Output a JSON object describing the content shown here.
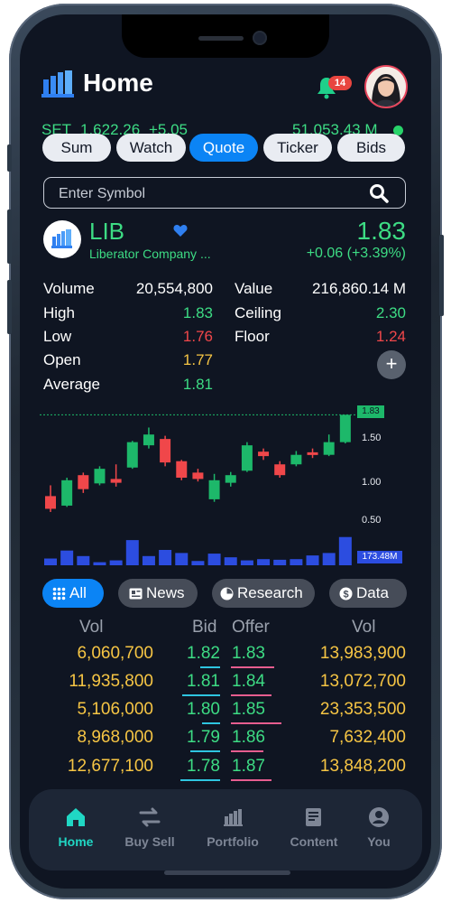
{
  "header": {
    "title": "Home",
    "notification_count": "14"
  },
  "market": {
    "index_name": "SET",
    "index_value": "1,622.26",
    "index_change": "+5.05",
    "value": "51,053.43 M"
  },
  "tabs": [
    {
      "label": "Sum"
    },
    {
      "label": "Watch"
    },
    {
      "label": "Quote",
      "active": true
    },
    {
      "label": "Ticker"
    },
    {
      "label": "Bids"
    }
  ],
  "search": {
    "placeholder": "Enter Symbol"
  },
  "stock": {
    "symbol": "LIB",
    "company": "Liberator Company ...",
    "price": "1.83",
    "change": "+0.06 (+3.39%)"
  },
  "stats_left": [
    {
      "label": "Volume",
      "value": "20,554,800",
      "color": "#ffffff"
    },
    {
      "label": "High",
      "value": "1.83",
      "color": "#3ddc84"
    },
    {
      "label": "Low",
      "value": "1.76",
      "color": "#f0474a"
    },
    {
      "label": "Open",
      "value": "1.77",
      "color": "#f6c544"
    },
    {
      "label": "Average",
      "value": "1.81",
      "color": "#3ddc84"
    }
  ],
  "stats_right": [
    {
      "label": "Value",
      "value": "216,860.14 M",
      "color": "#ffffff"
    },
    {
      "label": "Ceiling",
      "value": "2.30",
      "color": "#3ddc84"
    },
    {
      "label": "Floor",
      "value": "1.24",
      "color": "#f0474a"
    }
  ],
  "chart": {
    "last_price_tag": "1.83",
    "y_ticks": [
      "1.50",
      "1.00",
      "0.50"
    ],
    "volume_tag": "173.48M"
  },
  "chart_data": {
    "type": "candlestick",
    "y_ticks": [
      0.5,
      1.0,
      1.5
    ],
    "last_price": 1.83,
    "candles": [
      {
        "open": 0.35,
        "close": 0.55,
        "high": 0.72,
        "low": 0.3,
        "dir": "down"
      },
      {
        "open": 0.4,
        "close": 0.8,
        "high": 0.84,
        "low": 0.38,
        "dir": "up"
      },
      {
        "open": 0.88,
        "close": 0.66,
        "high": 0.92,
        "low": 0.6,
        "dir": "down"
      },
      {
        "open": 0.75,
        "close": 0.98,
        "high": 1.02,
        "low": 0.72,
        "dir": "up"
      },
      {
        "open": 0.82,
        "close": 0.76,
        "high": 1.05,
        "low": 0.7,
        "dir": "down"
      },
      {
        "open": 1.0,
        "close": 1.4,
        "high": 1.42,
        "low": 0.98,
        "dir": "up"
      },
      {
        "open": 1.35,
        "close": 1.52,
        "high": 1.63,
        "low": 1.3,
        "dir": "up"
      },
      {
        "open": 1.45,
        "close": 1.08,
        "high": 1.5,
        "low": 1.02,
        "dir": "down"
      },
      {
        "open": 1.1,
        "close": 0.84,
        "high": 1.12,
        "low": 0.8,
        "dir": "down"
      },
      {
        "open": 0.92,
        "close": 0.82,
        "high": 0.98,
        "low": 0.78,
        "dir": "down"
      },
      {
        "open": 0.5,
        "close": 0.8,
        "high": 0.9,
        "low": 0.46,
        "dir": "up"
      },
      {
        "open": 0.76,
        "close": 0.88,
        "high": 0.93,
        "low": 0.7,
        "dir": "up"
      },
      {
        "open": 0.95,
        "close": 1.35,
        "high": 1.4,
        "low": 0.93,
        "dir": "up"
      },
      {
        "open": 1.25,
        "close": 1.18,
        "high": 1.3,
        "low": 1.12,
        "dir": "down"
      },
      {
        "open": 1.05,
        "close": 0.88,
        "high": 1.1,
        "low": 0.84,
        "dir": "down"
      },
      {
        "open": 1.05,
        "close": 1.2,
        "high": 1.26,
        "low": 1.02,
        "dir": "up"
      },
      {
        "open": 1.2,
        "close": 1.24,
        "high": 1.3,
        "low": 1.15,
        "dir": "down"
      },
      {
        "open": 1.2,
        "close": 1.4,
        "high": 1.52,
        "low": 1.18,
        "dir": "up"
      },
      {
        "open": 1.4,
        "close": 1.83,
        "high": 1.83,
        "low": 1.38,
        "dir": "up"
      }
    ],
    "volumes": [
      0.22,
      0.48,
      0.3,
      0.1,
      0.16,
      0.82,
      0.3,
      0.5,
      0.4,
      0.14,
      0.38,
      0.26,
      0.16,
      0.2,
      0.18,
      0.2,
      0.32,
      0.4,
      0.92
    ]
  },
  "content_tabs": [
    {
      "label": "All",
      "icon": "grid-icon",
      "active": true
    },
    {
      "label": "News",
      "icon": "news-icon"
    },
    {
      "label": "Research",
      "icon": "pie-chart-icon"
    },
    {
      "label": "Data",
      "icon": "dollar-icon"
    }
  ],
  "bidoffer": {
    "headers": {
      "vol_left": "Vol",
      "bid": "Bid",
      "offer": "Offer",
      "vol_right": "Vol"
    },
    "rows": [
      {
        "bid_vol": "6,060,700",
        "bid": "1.82",
        "offer": "1.83",
        "offer_vol": "13,983,900",
        "bid_depth": 0.5,
        "offer_depth": 0.85
      },
      {
        "bid_vol": "11,935,800",
        "bid": "1.81",
        "offer": "1.84",
        "offer_vol": "13,072,700",
        "bid_depth": 0.95,
        "offer_depth": 0.8
      },
      {
        "bid_vol": "5,106,000",
        "bid": "1.80",
        "offer": "1.85",
        "offer_vol": "23,353,500",
        "bid_depth": 0.45,
        "offer_depth": 1.0
      },
      {
        "bid_vol": "8,968,000",
        "bid": "1.79",
        "offer": "1.86",
        "offer_vol": "7,632,400",
        "bid_depth": 0.75,
        "offer_depth": 0.65
      },
      {
        "bid_vol": "12,677,100",
        "bid": "1.78",
        "offer": "1.87",
        "offer_vol": "13,848,200",
        "bid_depth": 1.0,
        "offer_depth": 0.8
      }
    ]
  },
  "nav": [
    {
      "label": "Home",
      "icon": "home-icon",
      "active": true
    },
    {
      "label": "Buy Sell",
      "icon": "swap-icon"
    },
    {
      "label": "Portfolio",
      "icon": "portfolio-icon"
    },
    {
      "label": "Content",
      "icon": "content-icon"
    },
    {
      "label": "You",
      "icon": "user-icon"
    }
  ],
  "colors": {
    "up": "#1db86a",
    "down": "#f0474a",
    "volume": "#2c4de0",
    "accent": "#0b84f5"
  }
}
